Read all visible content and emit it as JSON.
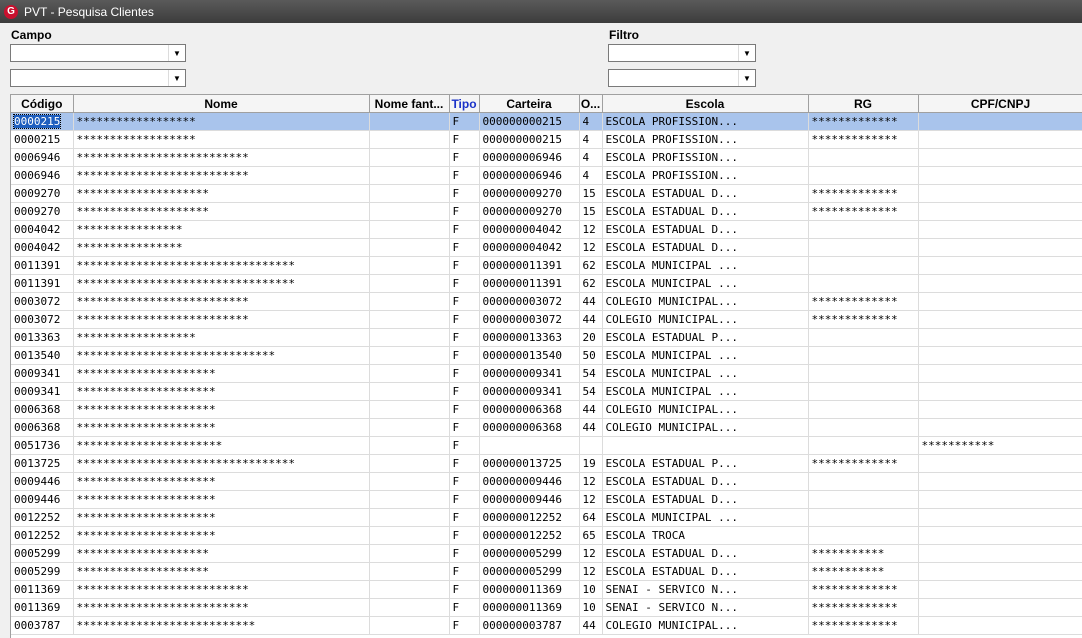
{
  "window": {
    "title": "PVT - Pesquisa Clientes",
    "icon_letter": "G"
  },
  "campo": {
    "label": "Campo",
    "combo1_value": "",
    "combo2_value": ""
  },
  "filtro": {
    "label": "Filtro",
    "combo1_value": "",
    "combo2_value": ""
  },
  "grid": {
    "columns": [
      "Código",
      "Nome",
      "Nome fant...",
      "Tipo",
      "Carteira",
      "O...",
      "Escola",
      "RG",
      "CPF/CNPJ"
    ],
    "rows": [
      [
        "0000215",
        "******************",
        "",
        "F",
        "000000000215",
        "4",
        "ESCOLA PROFISSION...",
        "*************",
        ""
      ],
      [
        "0000215",
        "******************",
        "",
        "F",
        "000000000215",
        "4",
        "ESCOLA PROFISSION...",
        "*************",
        ""
      ],
      [
        "0006946",
        "**************************",
        "",
        "F",
        "000000006946",
        "4",
        "ESCOLA PROFISSION...",
        "",
        ""
      ],
      [
        "0006946",
        "**************************",
        "",
        "F",
        "000000006946",
        "4",
        "ESCOLA PROFISSION...",
        "",
        ""
      ],
      [
        "0009270",
        "********************",
        "",
        "F",
        "000000009270",
        "15",
        "ESCOLA ESTADUAL D...",
        "*************",
        ""
      ],
      [
        "0009270",
        "********************",
        "",
        "F",
        "000000009270",
        "15",
        "ESCOLA ESTADUAL D...",
        "*************",
        ""
      ],
      [
        "0004042",
        "****************",
        "",
        "F",
        "000000004042",
        "12",
        "ESCOLA ESTADUAL D...",
        "",
        ""
      ],
      [
        "0004042",
        "****************",
        "",
        "F",
        "000000004042",
        "12",
        "ESCOLA ESTADUAL D...",
        "",
        ""
      ],
      [
        "0011391",
        "*********************************",
        "",
        "F",
        "000000011391",
        "62",
        "ESCOLA MUNICIPAL ...",
        "",
        ""
      ],
      [
        "0011391",
        "*********************************",
        "",
        "F",
        "000000011391",
        "62",
        "ESCOLA MUNICIPAL ...",
        "",
        ""
      ],
      [
        "0003072",
        "**************************",
        "",
        "F",
        "000000003072",
        "44",
        "COLEGIO MUNICIPAL...",
        "*************",
        ""
      ],
      [
        "0003072",
        "**************************",
        "",
        "F",
        "000000003072",
        "44",
        "COLEGIO MUNICIPAL...",
        "*************",
        ""
      ],
      [
        "0013363",
        "******************",
        "",
        "F",
        "000000013363",
        "20",
        "ESCOLA ESTADUAL P...",
        "",
        ""
      ],
      [
        "0013540",
        "******************************",
        "",
        "F",
        "000000013540",
        "50",
        "ESCOLA MUNICIPAL ...",
        "",
        ""
      ],
      [
        "0009341",
        "*********************",
        "",
        "F",
        "000000009341",
        "54",
        "ESCOLA MUNICIPAL ...",
        "",
        ""
      ],
      [
        "0009341",
        "*********************",
        "",
        "F",
        "000000009341",
        "54",
        "ESCOLA MUNICIPAL ...",
        "",
        ""
      ],
      [
        "0006368",
        "*********************",
        "",
        "F",
        "000000006368",
        "44",
        "COLEGIO MUNICIPAL...",
        "",
        ""
      ],
      [
        "0006368",
        "*********************",
        "",
        "F",
        "000000006368",
        "44",
        "COLEGIO MUNICIPAL...",
        "",
        ""
      ],
      [
        "0051736",
        "**********************",
        "",
        "F",
        "",
        "",
        "",
        "",
        "***********"
      ],
      [
        "0013725",
        "*********************************",
        "",
        "F",
        "000000013725",
        "19",
        "ESCOLA ESTADUAL P...",
        "*************",
        ""
      ],
      [
        "0009446",
        "*********************",
        "",
        "F",
        "000000009446",
        "12",
        "ESCOLA ESTADUAL D...",
        "",
        ""
      ],
      [
        "0009446",
        "*********************",
        "",
        "F",
        "000000009446",
        "12",
        "ESCOLA ESTADUAL D...",
        "",
        ""
      ],
      [
        "0012252",
        "*********************",
        "",
        "F",
        "000000012252",
        "64",
        "ESCOLA MUNICIPAL ...",
        "",
        ""
      ],
      [
        "0012252",
        "*********************",
        "",
        "F",
        "000000012252",
        "65",
        "ESCOLA TROCA",
        "",
        ""
      ],
      [
        "0005299",
        "********************",
        "",
        "F",
        "000000005299",
        "12",
        "ESCOLA ESTADUAL D...",
        "***********",
        ""
      ],
      [
        "0005299",
        "********************",
        "",
        "F",
        "000000005299",
        "12",
        "ESCOLA ESTADUAL D...",
        "***********",
        ""
      ],
      [
        "0011369",
        "**************************",
        "",
        "F",
        "000000011369",
        "10",
        "SENAI - SERVICO N...",
        "*************",
        ""
      ],
      [
        "0011369",
        "**************************",
        "",
        "F",
        "000000011369",
        "10",
        "SENAI - SERVICO N...",
        "*************",
        ""
      ],
      [
        "0003787",
        "***************************",
        "",
        "F",
        "000000003787",
        "44",
        "COLEGIO MUNICIPAL...",
        "*************",
        ""
      ]
    ]
  }
}
